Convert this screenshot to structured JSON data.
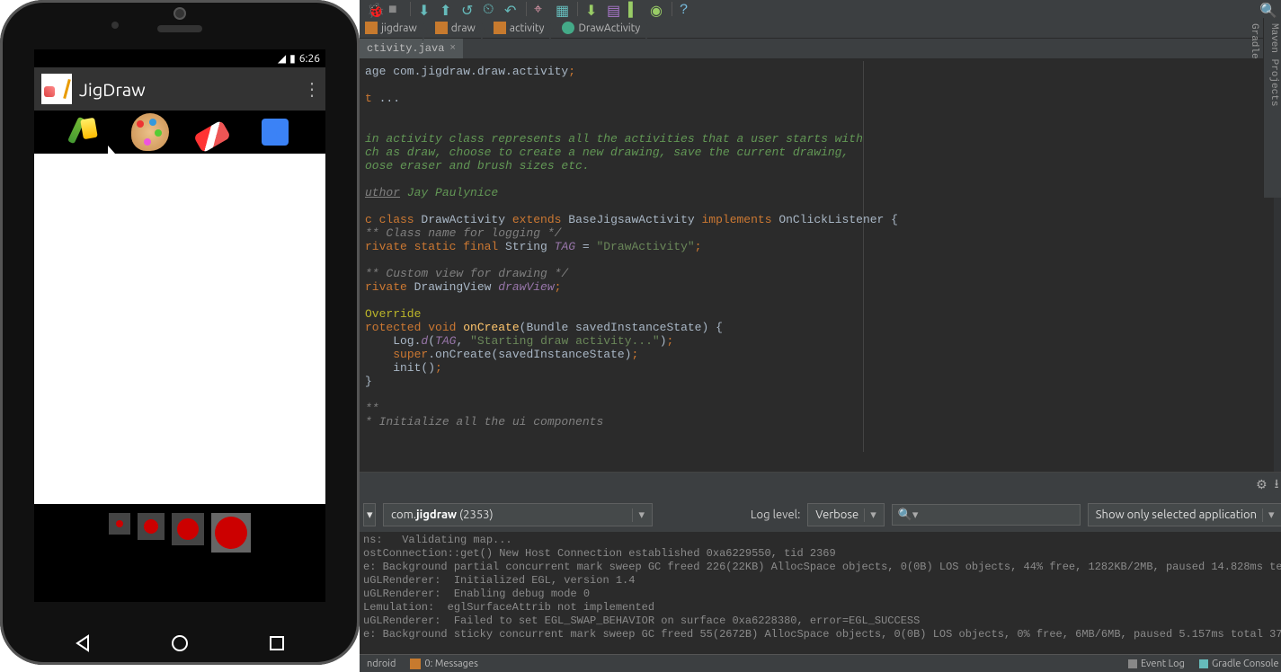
{
  "emulator": {
    "status_time": "6:26",
    "app_name": "JigDraw",
    "tools": [
      "brushes-icon",
      "palette-icon",
      "eraser-icon",
      "puzzle-icon"
    ],
    "brush_sizes": [
      "xs",
      "s",
      "m",
      "l"
    ]
  },
  "ide": {
    "breadcrumbs": [
      {
        "label": "jigdraw",
        "kind": "folder"
      },
      {
        "label": "draw",
        "kind": "folder"
      },
      {
        "label": "activity",
        "kind": "folder"
      },
      {
        "label": "DrawActivity",
        "kind": "class"
      }
    ],
    "tab_name": "ctivity.java",
    "search_glyph": "🔍",
    "code_lines": [
      {
        "t": "plain",
        "s": "age "
      },
      {
        "t": "kw",
        "s": ""
      },
      {
        "t": "id",
        "s": "com"
      },
      {
        "t": "plain",
        "s": "."
      },
      {
        "t": "id",
        "s": "jigdraw"
      },
      {
        "t": "plain",
        "s": "."
      },
      {
        "t": "id",
        "s": "draw"
      },
      {
        "t": "plain",
        "s": "."
      },
      {
        "t": "id",
        "s": "activity"
      },
      {
        "t": "plain",
        "s": ";"
      }
    ],
    "code_full": "age com.jigdraw.draw.activity;\n\nt ...\n\n\nin activity class represents all the activities that a user starts with\nch as draw, choose to create a new drawing, save the current drawing,\noose eraser and brush sizes etc.\n\nuthor Jay Paulynice\n\nc class DrawActivity extends BaseJigsawActivity implements OnClickListener {\n** Class name for logging */\nrivate static final String TAG = \"DrawActivity\";\n\n** Custom view for drawing */\nrivate DrawingView drawView;\n\nOverride\nrotected void onCreate(Bundle savedInstanceState) {\n    Log.d(TAG, \"Starting draw activity...\");\n    super.onCreate(savedInstanceState);\n    init();\n}\n\n**\n* Initialize all the ui components",
    "logcat": {
      "process": "com.jigdraw (2353)",
      "process_prefix": "com.",
      "process_bold": "jigdraw",
      "process_suffix": " (2353)",
      "log_level_label": "Log level:",
      "log_level_value": "Verbose",
      "filter_value": "Show only selected application",
      "search_placeholder": "",
      "lines": [
        "ns:   Validating map...",
        "ostConnection::get() New Host Connection established 0xa6229550, tid 2369",
        "e: Background partial concurrent mark sweep GC freed 226(22KB) AllocSpace objects, 0(0B) LOS objects, 44% free, 1282KB/2MB, paused 14.828ms te",
        "uGLRenderer:  Initialized EGL, version 1.4",
        "uGLRenderer:  Enabling debug mode 0",
        "Lemulation:  eglSurfaceAttrib not implemented",
        "uGLRenderer:  Failed to set EGL_SWAP_BEHAVIOR on surface 0xa6228380, error=EGL_SUCCESS",
        "e: Background sticky concurrent mark sweep GC freed 55(2672B) AllocSpace objects, 0(0B) LOS objects, 0% free, 6MB/6MB, paused 5.157ms total 37"
      ]
    },
    "bottom_status": {
      "android": "ndroid",
      "messages": "0: Messages",
      "event_log": "Event Log",
      "gradle_console": "Gradle Console"
    },
    "right_strip": [
      "Maven Projects",
      "Gradle"
    ]
  }
}
